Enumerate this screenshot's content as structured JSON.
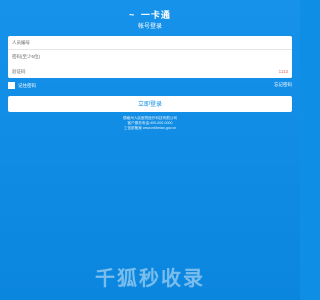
{
  "header": {
    "logo_text": "一卡通",
    "subtitle": "帐号登录"
  },
  "form": {
    "username_placeholder": "人员编号",
    "password_placeholder": "密码(至少6位)",
    "captcha_placeholder": "验证码",
    "captcha_code": "1113"
  },
  "options": {
    "remember_label": "记住密码",
    "forgot_label": "忘记密码"
  },
  "actions": {
    "login_label": "立即登录"
  },
  "footer": {
    "line1": "德格州人民医院医疗科技有限公司",
    "line2": "客户服务电话:400-000-0000",
    "line3": "工信部备案 www.miibeian.gov.cn"
  },
  "watermark": {
    "text": "千狐秒收录"
  },
  "colors": {
    "background": "#0f8ee6",
    "primary": "#ffffff",
    "accent": "#e26a6a"
  }
}
